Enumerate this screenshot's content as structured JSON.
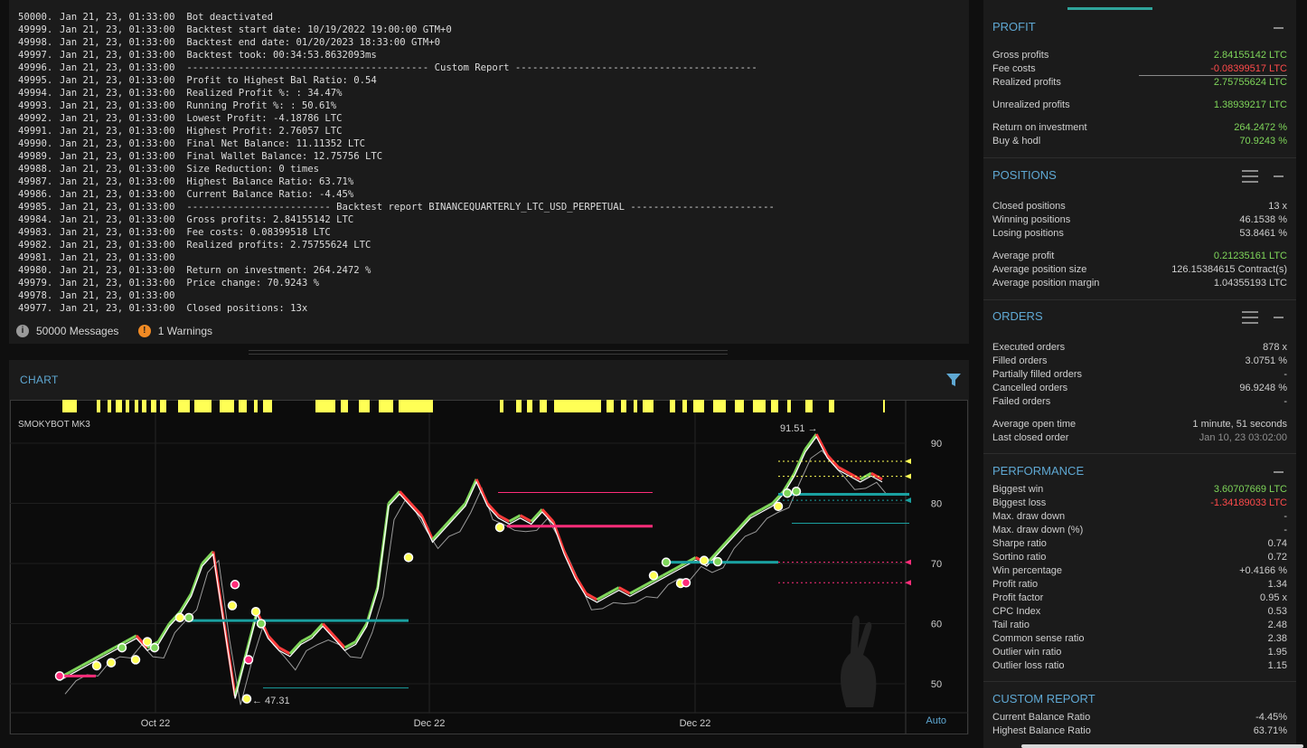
{
  "log": {
    "lines": [
      {
        "num": "50000.",
        "text": "Jan 21, 23, 01:33:00  Bot deactivated"
      },
      {
        "num": "49999.",
        "text": "Jan 21, 23, 01:33:00  Backtest start date: 10/19/2022 19:00:00 GTM+0"
      },
      {
        "num": "49998.",
        "text": "Jan 21, 23, 01:33:00  Backtest end date: 01/20/2023 18:33:00 GTM+0"
      },
      {
        "num": "49997.",
        "text": "Jan 21, 23, 01:33:00  Backtest took: 00:34:53.8632093ms"
      },
      {
        "num": "49996.",
        "text": "Jan 21, 23, 01:33:00  ------------------------------------------ Custom Report ------------------------------------------"
      },
      {
        "num": "49995.",
        "text": "Jan 21, 23, 01:33:00  Profit to Highest Bal Ratio: 0.54"
      },
      {
        "num": "49994.",
        "text": "Jan 21, 23, 01:33:00  Realized Profit %: : 34.47%"
      },
      {
        "num": "49993.",
        "text": "Jan 21, 23, 01:33:00  Running Profit %: : 50.61%"
      },
      {
        "num": "49992.",
        "text": "Jan 21, 23, 01:33:00  Lowest Profit: -4.18786 LTC"
      },
      {
        "num": "49991.",
        "text": "Jan 21, 23, 01:33:00  Highest Profit: 2.76057 LTC"
      },
      {
        "num": "49990.",
        "text": "Jan 21, 23, 01:33:00  Final Net Balance: 11.11352 LTC"
      },
      {
        "num": "49989.",
        "text": "Jan 21, 23, 01:33:00  Final Wallet Balance: 12.75756 LTC"
      },
      {
        "num": "49988.",
        "text": "Jan 21, 23, 01:33:00  Size Reduction: 0 times"
      },
      {
        "num": "49987.",
        "text": "Jan 21, 23, 01:33:00  Highest Balance Ratio: 63.71%"
      },
      {
        "num": "49986.",
        "text": "Jan 21, 23, 01:33:00  Current Balance Ratio: -4.45%"
      },
      {
        "num": "49985.",
        "text": "Jan 21, 23, 01:33:00  ------------------------- Backtest report BINANCEQUARTERLY_LTC_USD_PERPETUAL -------------------------"
      },
      {
        "num": "49984.",
        "text": "Jan 21, 23, 01:33:00  Gross profits: 2.84155142 LTC"
      },
      {
        "num": "49983.",
        "text": "Jan 21, 23, 01:33:00  Fee costs: 0.08399518 LTC"
      },
      {
        "num": "49982.",
        "text": "Jan 21, 23, 01:33:00  Realized profits: 2.75755624 LTC"
      },
      {
        "num": "49981.",
        "text": "Jan 21, 23, 01:33:00"
      },
      {
        "num": "49980.",
        "text": "Jan 21, 23, 01:33:00  Return on investment: 264.2472 %"
      },
      {
        "num": "49979.",
        "text": "Jan 21, 23, 01:33:00  Price change: 70.9243 %"
      },
      {
        "num": "49978.",
        "text": "Jan 21, 23, 01:33:00"
      },
      {
        "num": "49977.",
        "text": "Jan 21, 23, 01:33:00  Closed positions: 13x"
      }
    ],
    "footer": {
      "messages": "50000 Messages",
      "warnings": "1 Warnings"
    }
  },
  "chart": {
    "title": "CHART",
    "bot_label": "SMOKYBOT MK3",
    "auto_label": "Auto",
    "high_label": "91.51",
    "low_label": "47.31",
    "colors": {
      "price_up": "#7fd65a",
      "price_down": "#ff3b3b",
      "ma": "#ffffff",
      "trail": "#9a9a9a",
      "teal": "#1aa0a0",
      "pink": "#ff2d7a",
      "yellow": "#ffff55",
      "accent": "#5fa8d3"
    }
  },
  "chart_data": {
    "type": "line",
    "title": "",
    "xlabel": "",
    "ylabel": "",
    "x_ticks": [
      "Oct 22",
      "Dec 22",
      "Dec 22"
    ],
    "y_ticks": [
      50,
      60,
      70,
      80,
      90
    ],
    "ylim": [
      47,
      93
    ],
    "grid": true,
    "annotations": [
      {
        "text": "91.51"
      },
      {
        "text": "47.31"
      }
    ],
    "series": [
      {
        "values": [
          51,
          52,
          53,
          54,
          55,
          56,
          57,
          58,
          56,
          57,
          60,
          62,
          65,
          70,
          72,
          60,
          48,
          55,
          62,
          58,
          56,
          55,
          57,
          58,
          60,
          58,
          56,
          57,
          60,
          66,
          80,
          82,
          80,
          78,
          74,
          76,
          78,
          80,
          84,
          80,
          78,
          77,
          78,
          77,
          79,
          77,
          72,
          68,
          65,
          64,
          65,
          66,
          65,
          66,
          67,
          68,
          69,
          70,
          71,
          70,
          72,
          74,
          76,
          78,
          79,
          80,
          82,
          85,
          89,
          91.5,
          88,
          86,
          85,
          84,
          85,
          84
        ]
      }
    ]
  },
  "profit": {
    "title": "PROFIT",
    "rows": [
      {
        "k": "Gross profits",
        "v": "2.84155142 LTC",
        "c": "green"
      },
      {
        "k": "Fee costs",
        "v": "-0.08399517 LTC",
        "c": "red"
      },
      {
        "k": "Realized profits",
        "v": "2.75755624 LTC",
        "c": "green"
      },
      {
        "k": "Unrealized profits",
        "v": "1.38939217 LTC",
        "c": "green"
      },
      {
        "k": "Return on investment",
        "v": "264.2472 %",
        "c": "green"
      },
      {
        "k": "Buy & hodl",
        "v": "70.9243 %",
        "c": "green"
      }
    ]
  },
  "positions": {
    "title": "POSITIONS",
    "rows": [
      {
        "k": "Closed positions",
        "v": "13 x",
        "c": ""
      },
      {
        "k": "Winning positions",
        "v": "46.1538 %",
        "c": ""
      },
      {
        "k": "Losing positions",
        "v": "53.8461 %",
        "c": ""
      },
      {
        "k": "Average profit",
        "v": "0.21235161 LTC",
        "c": "green"
      },
      {
        "k": "Average position size",
        "v": "126.15384615 Contract(s)",
        "c": ""
      },
      {
        "k": "Average position margin",
        "v": "1.04355193 LTC",
        "c": ""
      }
    ]
  },
  "orders": {
    "title": "ORDERS",
    "rows": [
      {
        "k": "Executed orders",
        "v": "878 x",
        "c": ""
      },
      {
        "k": "Filled orders",
        "v": "3.0751 %",
        "c": ""
      },
      {
        "k": "Partially filled orders",
        "v": "-",
        "c": ""
      },
      {
        "k": "Cancelled orders",
        "v": "96.9248 %",
        "c": ""
      },
      {
        "k": "Failed orders",
        "v": "-",
        "c": ""
      },
      {
        "k": "Average open time",
        "v": "1 minute, 51 seconds",
        "c": ""
      },
      {
        "k": "Last closed order",
        "v": "Jan 10, 23   03:02:00",
        "c": "muted"
      }
    ]
  },
  "performance": {
    "title": "PERFORMANCE",
    "rows": [
      {
        "k": "Biggest win",
        "v": "3.60707669 LTC",
        "c": "green"
      },
      {
        "k": "Biggest loss",
        "v": "-1.34189033 LTC",
        "c": "red"
      },
      {
        "k": "Max. draw down",
        "v": "-",
        "c": ""
      },
      {
        "k": "Max. draw down (%)",
        "v": "-",
        "c": ""
      },
      {
        "k": "Sharpe ratio",
        "v": "0.74",
        "c": ""
      },
      {
        "k": "Sortino ratio",
        "v": "0.72",
        "c": ""
      },
      {
        "k": "Win percentage",
        "v": "+0.4166 %",
        "c": ""
      },
      {
        "k": "Profit ratio",
        "v": "1.34",
        "c": ""
      },
      {
        "k": "Profit factor",
        "v": "0.95 x",
        "c": ""
      },
      {
        "k": "CPC Index",
        "v": "0.53",
        "c": ""
      },
      {
        "k": "Tail ratio",
        "v": "2.48",
        "c": ""
      },
      {
        "k": "Common sense ratio",
        "v": "2.38",
        "c": ""
      },
      {
        "k": "Outlier win ratio",
        "v": "1.95",
        "c": ""
      },
      {
        "k": "Outlier loss ratio",
        "v": "1.15",
        "c": ""
      }
    ]
  },
  "custom_report": {
    "title": "CUSTOM REPORT",
    "rows": [
      {
        "k": "Current Balance Ratio",
        "v": "-4.45%",
        "c": ""
      },
      {
        "k": "Highest Balance Ratio",
        "v": "63.71%",
        "c": ""
      }
    ]
  }
}
